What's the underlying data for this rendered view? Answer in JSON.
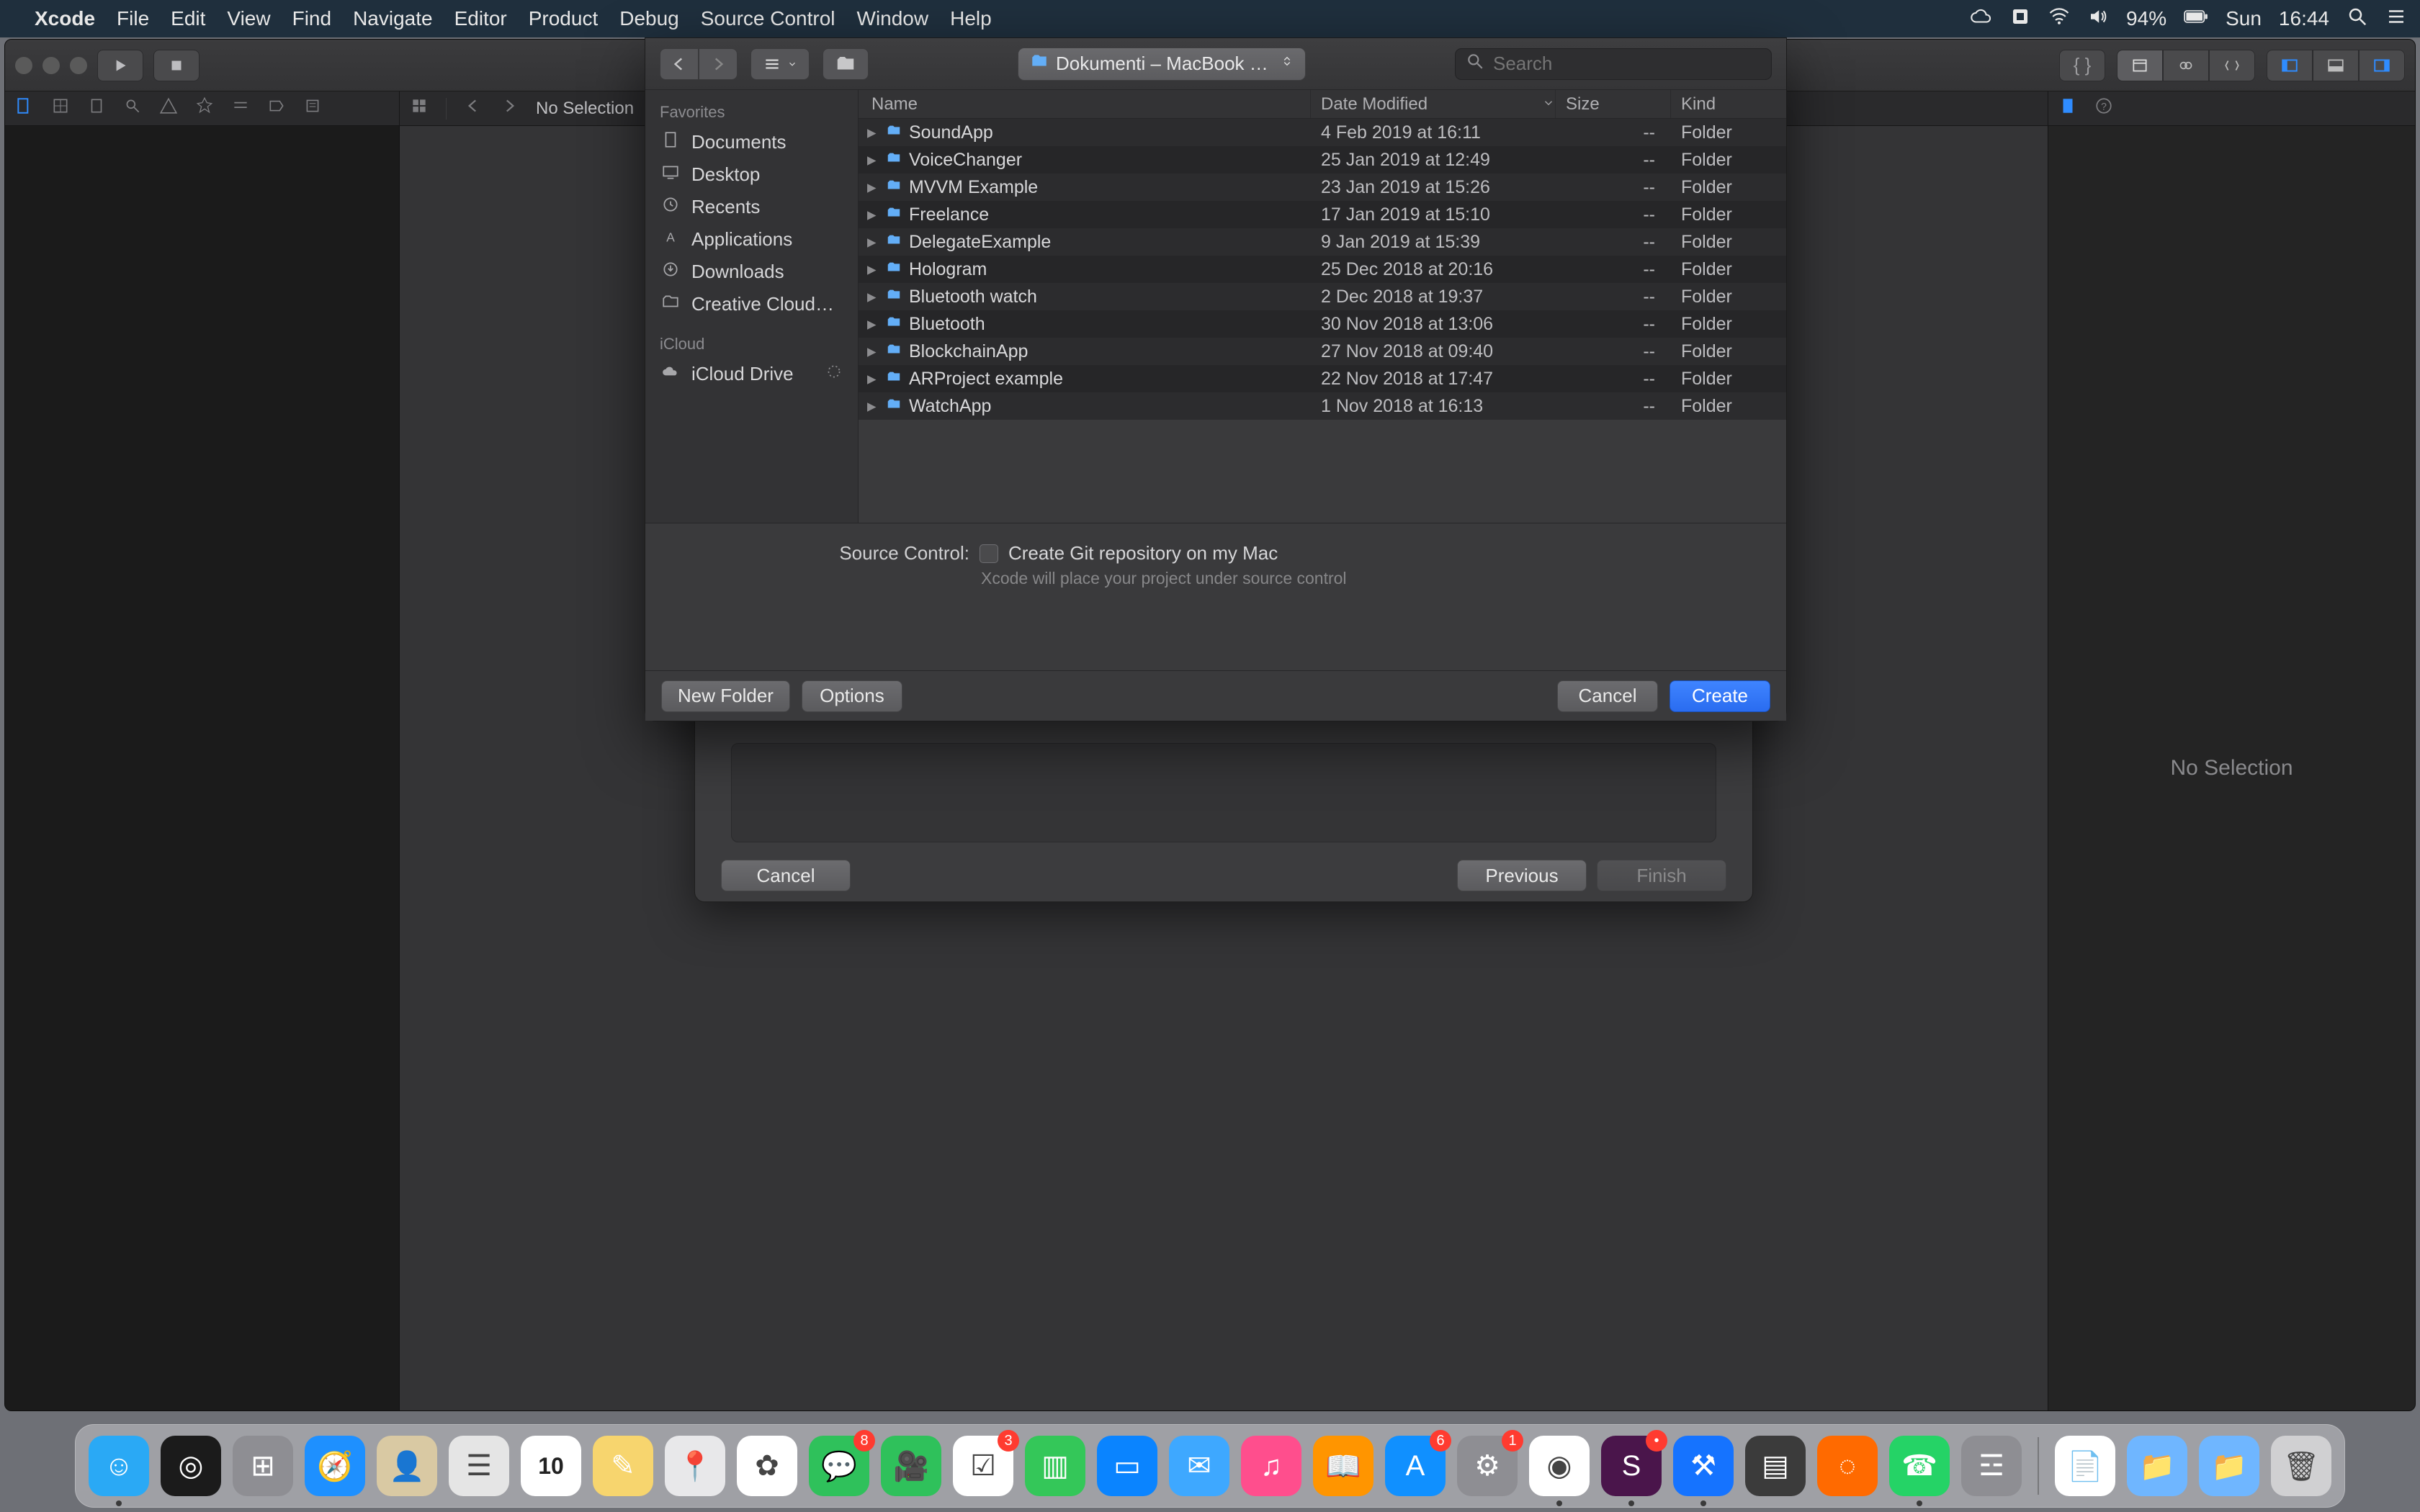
{
  "menubar": {
    "app": "Xcode",
    "items": [
      "File",
      "Edit",
      "View",
      "Find",
      "Navigate",
      "Editor",
      "Product",
      "Debug",
      "Source Control",
      "Window",
      "Help"
    ],
    "battery": "94%",
    "day": "Sun",
    "time": "16:44"
  },
  "xcode": {
    "secondary": {
      "no_selection": "No Selection"
    },
    "right_panel": {
      "placeholder": "No Selection"
    }
  },
  "wizard": {
    "cancel": "Cancel",
    "previous": "Previous",
    "finish": "Finish"
  },
  "save_dialog": {
    "path_label": "Dokumenti – MacBook Pr…",
    "search_placeholder": "Search",
    "sidebar": {
      "favorites_heading": "Favorites",
      "favorites": [
        "Documents",
        "Desktop",
        "Recents",
        "Applications",
        "Downloads",
        "Creative Cloud…"
      ],
      "icloud_heading": "iCloud",
      "icloud_drive": "iCloud Drive"
    },
    "columns": {
      "name": "Name",
      "date": "Date Modified",
      "size": "Size",
      "kind": "Kind"
    },
    "rows": [
      {
        "name": "SoundApp",
        "date": "4 Feb 2019 at 16:11",
        "size": "--",
        "kind": "Folder"
      },
      {
        "name": "VoiceChanger",
        "date": "25 Jan 2019 at 12:49",
        "size": "--",
        "kind": "Folder"
      },
      {
        "name": "MVVM Example",
        "date": "23 Jan 2019 at 15:26",
        "size": "--",
        "kind": "Folder"
      },
      {
        "name": "Freelance",
        "date": "17 Jan 2019 at 15:10",
        "size": "--",
        "kind": "Folder"
      },
      {
        "name": "DelegateExample",
        "date": "9 Jan 2019 at 15:39",
        "size": "--",
        "kind": "Folder"
      },
      {
        "name": "Hologram",
        "date": "25 Dec 2018 at 20:16",
        "size": "--",
        "kind": "Folder"
      },
      {
        "name": "Bluetooth watch",
        "date": "2 Dec 2018 at 19:37",
        "size": "--",
        "kind": "Folder"
      },
      {
        "name": "Bluetooth",
        "date": "30 Nov 2018 at 13:06",
        "size": "--",
        "kind": "Folder"
      },
      {
        "name": "BlockchainApp",
        "date": "27 Nov 2018 at 09:40",
        "size": "--",
        "kind": "Folder"
      },
      {
        "name": "ARProject example",
        "date": "22 Nov 2018 at 17:47",
        "size": "--",
        "kind": "Folder"
      },
      {
        "name": "WatchApp",
        "date": "1 Nov 2018 at 16:13",
        "size": "--",
        "kind": "Folder"
      }
    ],
    "source_control": {
      "label": "Source Control:",
      "checkbox": "Create Git repository on my Mac",
      "subtext": "Xcode will place your project under source control"
    },
    "buttons": {
      "new_folder": "New Folder",
      "options": "Options",
      "cancel": "Cancel",
      "create": "Create"
    }
  },
  "dock": {
    "apps": [
      {
        "name": "finder",
        "bg": "#2aa9f5",
        "running": true,
        "glyph": "☺"
      },
      {
        "name": "siri",
        "bg": "#1b1b1b",
        "running": false,
        "glyph": "◎"
      },
      {
        "name": "launchpad",
        "bg": "#8e8e93",
        "running": false,
        "glyph": "⊞"
      },
      {
        "name": "safari",
        "bg": "#1e90ff",
        "running": false,
        "glyph": "🧭"
      },
      {
        "name": "contacts",
        "bg": "#d9c9a3",
        "running": false,
        "glyph": "👤"
      },
      {
        "name": "reminders",
        "bg": "#e5e5e5",
        "running": false,
        "glyph": "☰"
      },
      {
        "name": "calendar",
        "bg": "#ffffff",
        "running": false,
        "glyph": "10"
      },
      {
        "name": "notes",
        "bg": "#f7d56e",
        "running": false,
        "glyph": "✎"
      },
      {
        "name": "maps",
        "bg": "#e8e8ea",
        "running": false,
        "glyph": "📍"
      },
      {
        "name": "photos",
        "bg": "#ffffff",
        "running": false,
        "glyph": "✿"
      },
      {
        "name": "messages",
        "bg": "#2fc15b",
        "running": false,
        "glyph": "💬",
        "badge": "8"
      },
      {
        "name": "facetime",
        "bg": "#2fc15b",
        "running": false,
        "glyph": "🎥"
      },
      {
        "name": "reminders2",
        "bg": "#ffffff",
        "running": false,
        "glyph": "☑",
        "badge": "3"
      },
      {
        "name": "numbers",
        "bg": "#34c759",
        "running": false,
        "glyph": "▥"
      },
      {
        "name": "keynote",
        "bg": "#0a84ff",
        "running": false,
        "glyph": "▭"
      },
      {
        "name": "mail",
        "bg": "#3ea8ff",
        "running": false,
        "glyph": "✉"
      },
      {
        "name": "itunes",
        "bg": "#ff4e8d",
        "running": false,
        "glyph": "♫"
      },
      {
        "name": "ibooks",
        "bg": "#ff9500",
        "running": false,
        "glyph": "📖"
      },
      {
        "name": "appstore",
        "bg": "#1090ff",
        "running": false,
        "glyph": "A",
        "badge": "6"
      },
      {
        "name": "preferences",
        "bg": "#8e8e93",
        "running": false,
        "glyph": "⚙",
        "badge": "1"
      },
      {
        "name": "chrome",
        "bg": "#ffffff",
        "running": true,
        "glyph": "◉"
      },
      {
        "name": "slack",
        "bg": "#4a154b",
        "running": true,
        "glyph": "S",
        "badge": "•"
      },
      {
        "name": "xcode",
        "bg": "#1573ff",
        "running": true,
        "glyph": "⚒"
      },
      {
        "name": "sublime",
        "bg": "#3b3b3b",
        "running": false,
        "glyph": "▤"
      },
      {
        "name": "spinner",
        "bg": "#ff6a00",
        "running": false,
        "glyph": "◌"
      },
      {
        "name": "whatsapp",
        "bg": "#25d366",
        "running": true,
        "glyph": "☎"
      },
      {
        "name": "todo",
        "bg": "#8e8e93",
        "running": false,
        "glyph": "☲"
      }
    ],
    "right": [
      {
        "name": "document",
        "bg": "#ffffff",
        "glyph": "📄"
      },
      {
        "name": "folder-pin",
        "bg": "#6fb6ff",
        "glyph": "📁"
      },
      {
        "name": "desktop-folder",
        "bg": "#6fb6ff",
        "glyph": "📁"
      },
      {
        "name": "trash",
        "bg": "#d0d0d2",
        "glyph": "🗑"
      }
    ]
  }
}
